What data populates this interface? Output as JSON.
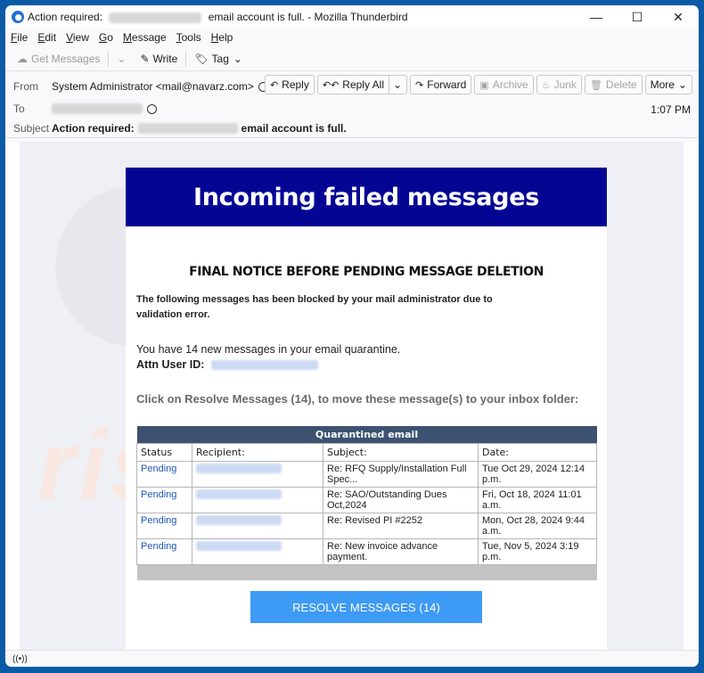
{
  "window": {
    "title_prefix": "Action required:",
    "title_suffix": "email account is full. - Mozilla Thunderbird",
    "controls": {
      "minimize": "—",
      "maximize": "☐",
      "close": "✕"
    }
  },
  "menu": [
    {
      "label": "File",
      "key": "F",
      "rest": "ile"
    },
    {
      "label": "Edit",
      "key": "E",
      "rest": "dit"
    },
    {
      "label": "View",
      "key": "V",
      "rest": "iew"
    },
    {
      "label": "Go",
      "key": "G",
      "rest": "o"
    },
    {
      "label": "Message",
      "key": "M",
      "rest": "essage"
    },
    {
      "label": "Tools",
      "key": "T",
      "rest": "ools"
    },
    {
      "label": "Help",
      "key": "H",
      "rest": "elp"
    }
  ],
  "toolbar": {
    "get_messages": "Get Messages",
    "write": "Write",
    "tag": "Tag"
  },
  "header": {
    "from_label": "From",
    "from_value": "System Administrator <mail@navarz.com>",
    "to_label": "To",
    "subject_label": "Subject",
    "subject_prefix": "Action required:",
    "subject_suffix": "email account is full.",
    "time": "1:07 PM",
    "buttons": {
      "reply": "Reply",
      "reply_all": "Reply All",
      "forward": "Forward",
      "archive": "Archive",
      "junk": "Junk",
      "delete": "Delete",
      "more": "More"
    }
  },
  "email": {
    "banner_title": "Incoming failed messages",
    "notice": "FINAL NOTICE BEFORE PENDING MESSAGE DELETION",
    "paragraph1": "The following messages has been blocked by your mail administrator due to validation error.",
    "paragraph2": "You have 14 new messages in your email quarantine.",
    "attn_label": "Attn User ID:",
    "instruction": "Click on Resolve Messages (14), to move these message(s) to your inbox folder:",
    "table": {
      "caption": "Quarantined email",
      "columns": [
        "Status",
        "Recipient:",
        "Subject:",
        "Date:"
      ],
      "rows": [
        {
          "status": "Pending",
          "subject": "Re: RFQ Supply/Installation Full Spec...",
          "date": "Tue Oct 29, 2024 12:14 p.m."
        },
        {
          "status": "Pending",
          "subject": "Re: SAO/Outstanding Dues Oct,2024",
          "date": "Fri, Oct 18, 2024 11:01 a.m."
        },
        {
          "status": "Pending",
          "subject": "Re: Revised PI #2252",
          "date": "Mon, Oct 28, 2024 9:44 a.m."
        },
        {
          "status": "Pending",
          "subject": "Re: New invoice advance payment.",
          "date": "Tue, Nov 5, 2024 3:19 p.m."
        }
      ]
    },
    "button_label": "RESOLVE MESSAGES (14)",
    "watermark": "risk.com"
  },
  "colors": {
    "banner": "#050594",
    "table_caption": "#3c5270",
    "button": "#3d9af5",
    "link": "#1d55b5"
  }
}
